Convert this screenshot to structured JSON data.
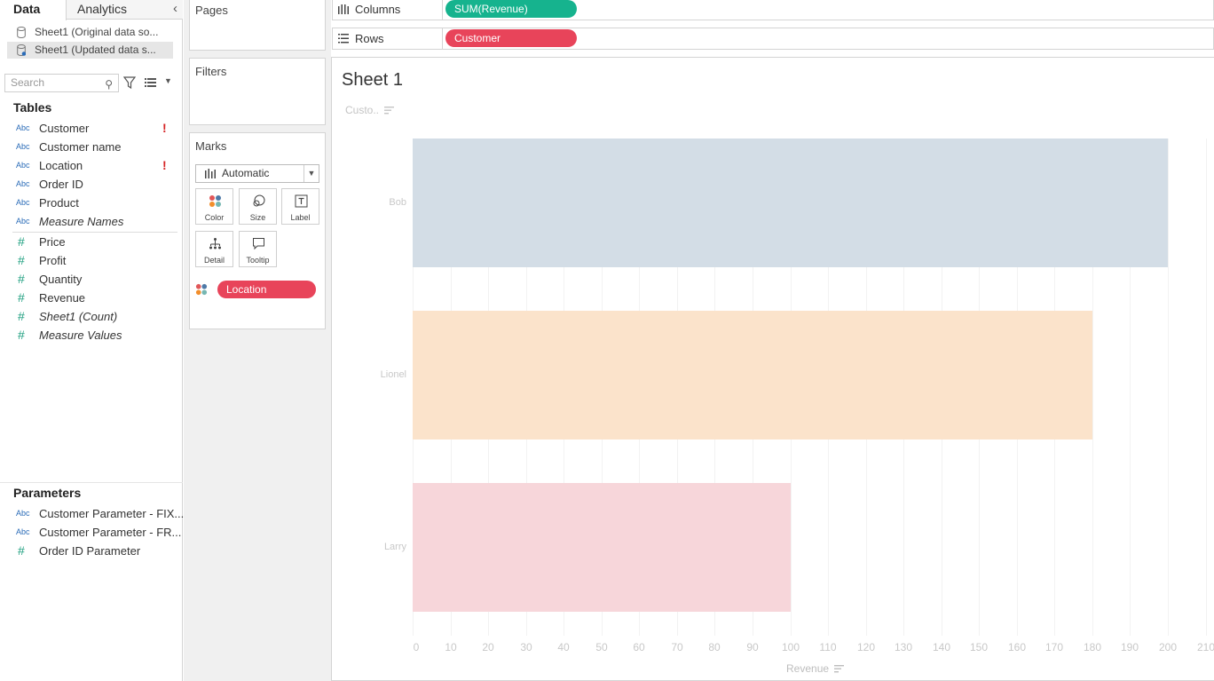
{
  "data_pane": {
    "tabs": [
      {
        "label": "Data"
      },
      {
        "label": "Analytics"
      }
    ],
    "datasources": [
      {
        "label": "Sheet1 (Original data so..."
      },
      {
        "label": "Sheet1 (Updated data s..."
      }
    ],
    "search_placeholder": "Search",
    "tables_title": "Tables",
    "dimensions": [
      {
        "type": "Abc",
        "label": "Customer",
        "warning": "!"
      },
      {
        "type": "Abc",
        "label": "Customer name"
      },
      {
        "type": "Abc",
        "label": "Location",
        "warning": "!"
      },
      {
        "type": "Abc",
        "label": "Order ID"
      },
      {
        "type": "Abc",
        "label": "Product"
      },
      {
        "type": "Abc",
        "label": "Measure Names"
      }
    ],
    "measures": [
      {
        "type": "#",
        "label": "Price"
      },
      {
        "type": "#",
        "label": "Profit"
      },
      {
        "type": "#",
        "label": "Quantity"
      },
      {
        "type": "#",
        "label": "Revenue"
      },
      {
        "type": "#",
        "label": "Sheet1 (Count)"
      },
      {
        "type": "#",
        "label": "Measure Values"
      }
    ],
    "parameters_title": "Parameters",
    "parameters": [
      {
        "type": "Abc",
        "label": "Customer Parameter - FIX..."
      },
      {
        "type": "Abc",
        "label": "Customer Parameter - FR..."
      },
      {
        "type": "#",
        "label": "Order ID Parameter"
      }
    ]
  },
  "cards": {
    "pages": "Pages",
    "filters": "Filters",
    "marks": "Marks",
    "mark_type": "Automatic",
    "mark_buttons": [
      "Color",
      "Size",
      "Label",
      "Detail",
      "Tooltip"
    ],
    "marks_pill": "Location"
  },
  "shelves": {
    "columns_label": "Columns",
    "columns_pill": "SUM(Revenue)",
    "rows_label": "Rows",
    "rows_pill": "Customer"
  },
  "view": {
    "sheet_title": "Sheet 1",
    "row_header_label": "Custo..",
    "x_axis_title": "Revenue"
  },
  "colors": {
    "bob": "#d3dde6",
    "lionel": "#fbe3cb",
    "larry": "#f7d6da",
    "pill_red": "#e8445a",
    "pill_green": "#16b38e"
  },
  "chart_data": {
    "type": "bar",
    "orientation": "horizontal",
    "title": "Sheet 1",
    "categories": [
      "Bob",
      "Lionel",
      "Larry"
    ],
    "values": [
      200,
      180,
      100
    ],
    "xlabel": "Revenue",
    "ylabel": "Custo..",
    "xlim": [
      0,
      210
    ],
    "xticks": [
      "0",
      "10",
      "20",
      "30",
      "40",
      "50",
      "60",
      "70",
      "80",
      "90",
      "100",
      "110",
      "120",
      "130",
      "140",
      "150",
      "160",
      "170",
      "180",
      "190",
      "200",
      "210"
    ],
    "grid": true
  }
}
